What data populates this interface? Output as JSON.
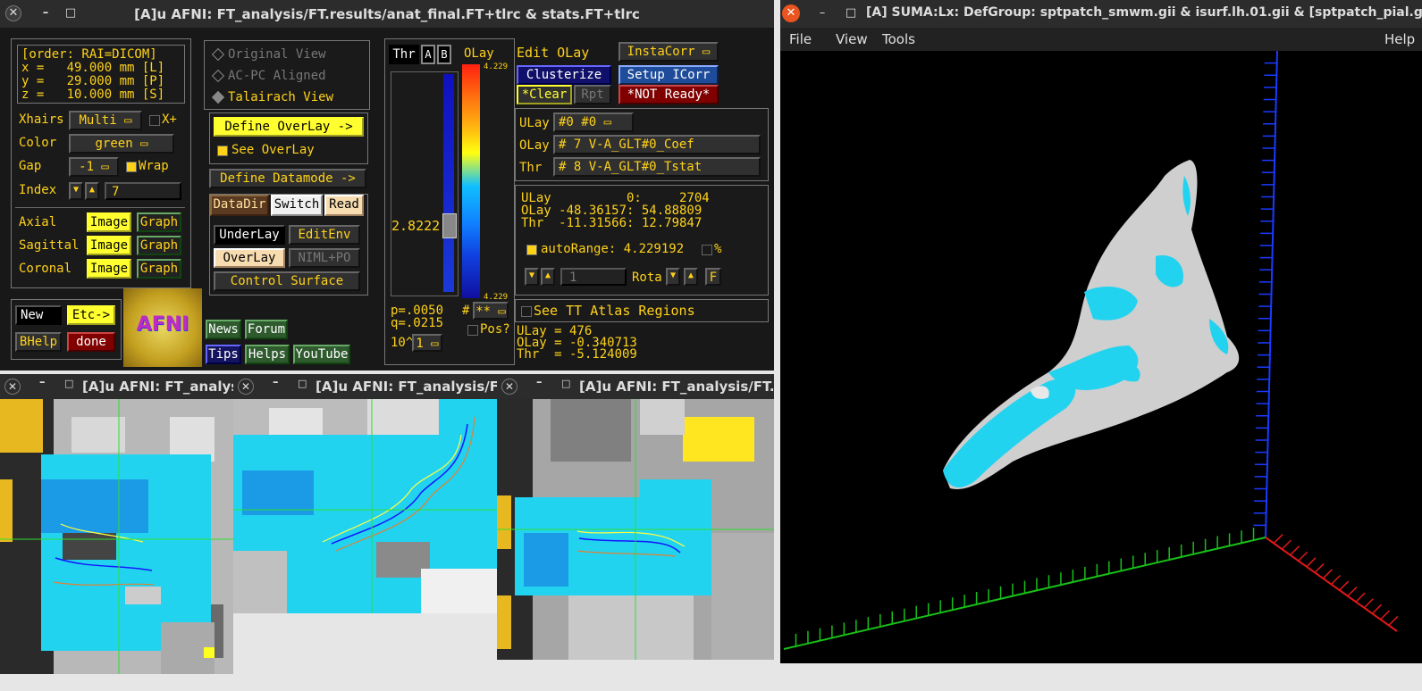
{
  "afni_window": {
    "title": "[A]u AFNI: FT_analysis/FT.results/anat_final.FT+tlrc & stats.FT+tlrc",
    "coords": {
      "order": "[order: RAI=DICOM]",
      "x": "x =   49.000 mm [L]",
      "y": "y =   29.000 mm [P]",
      "z": "z =   10.000 mm [S]"
    },
    "xhairs_label": "Xhairs",
    "xhairs_value": "Multi",
    "xplus_label": "X+",
    "color_label": "Color",
    "color_value": "green",
    "gap_label": "Gap",
    "gap_value": "-1",
    "wrap_label": "Wrap",
    "index_label": "Index",
    "index_value": "7",
    "views": [
      {
        "label": "Axial",
        "image": "Image",
        "graph": "Graph"
      },
      {
        "label": "Sagittal",
        "image": "Image",
        "graph": "Graph"
      },
      {
        "label": "Coronal",
        "image": "Image",
        "graph": "Graph"
      }
    ],
    "new_label": "New",
    "etc_label": "Etc->",
    "bhelp_label": "BHelp",
    "done_label": "done",
    "logo_text": "AFNI",
    "links": {
      "news": "News",
      "forum": "Forum",
      "tips": "Tips",
      "helps": "Helps",
      "youtube": "YouTube"
    },
    "view_modes": {
      "original": "Original View",
      "acpc": "AC-PC Aligned",
      "talairach": "Talairach View"
    },
    "define_overlay": "Define OverLay ->",
    "see_overlay": "See OverLay",
    "define_datamode": "Define Datamode ->",
    "datadir": "DataDir",
    "switch": "Switch",
    "read": "Read",
    "underlay": "UnderLay",
    "editenv": "EditEnv",
    "overlay_btn": "OverLay",
    "niml": "NIML+PO",
    "control_surface": "Control Surface",
    "thr_label": "Thr",
    "a_label": "A",
    "b_label": "B",
    "olay_label": "OLay",
    "colorbar_top": "4.229",
    "colorbar_bottom": "4.229",
    "thr_value": "2.8222",
    "p_value": "p=.0050",
    "q_value": "q=.0215",
    "pow_label": "10^",
    "pow_value": "1",
    "hash_label": "#",
    "star_value": "**",
    "pos_label": "Pos?",
    "edit_olay": "Edit OLay",
    "instacorr": "InstaCorr",
    "clusterize": "Clusterize",
    "setup_icorr": "Setup ICorr",
    "clear": "*Clear",
    "rpt": "Rpt",
    "not_ready": "*NOT Ready*",
    "ulay_row": {
      "label": "ULay",
      "value": "#0 #0"
    },
    "olay_row": {
      "label": "OLay",
      "value": "# 7 V-A_GLT#0_Coef"
    },
    "thr_row": {
      "label": "Thr",
      "value": "# 8 V-A_GLT#0_Tstat"
    },
    "info": {
      "ulay": "ULay          0:     2704",
      "olay": "OLay -48.36157: 54.88809",
      "thr": "Thr  -11.31566: 12.79847"
    },
    "autorange": "autoRange: 4.229192",
    "percent": "%",
    "rota_value": "1",
    "rota_label": "Rota",
    "f_label": "F",
    "see_tt": "See TT Atlas Regions",
    "vals": {
      "ulay": "ULay = 476",
      "olay": "OLay = -0.340713",
      "thr": "Thr  = -5.124009"
    }
  },
  "viewers": [
    {
      "title": "[A]u AFNI: FT_analysi..."
    },
    {
      "title": "[A]u AFNI: FT_analysis/FT.r..."
    },
    {
      "title": "[A]u AFNI: FT_analysis/FT.re..."
    }
  ],
  "suma_window": {
    "title": "[A] SUMA:Lx: DefGroup: sptpatch_smwm.gii & isurf.lh.01.gii &  [sptpatch_pial.gii]",
    "menu": {
      "file": "File",
      "view": "View",
      "tools": "Tools",
      "help": "Help"
    }
  },
  "colors": {
    "afni_yellow": "#ffd21a",
    "overlay_cyan": "#22d3f0",
    "button_yellow": "#ffff30"
  }
}
